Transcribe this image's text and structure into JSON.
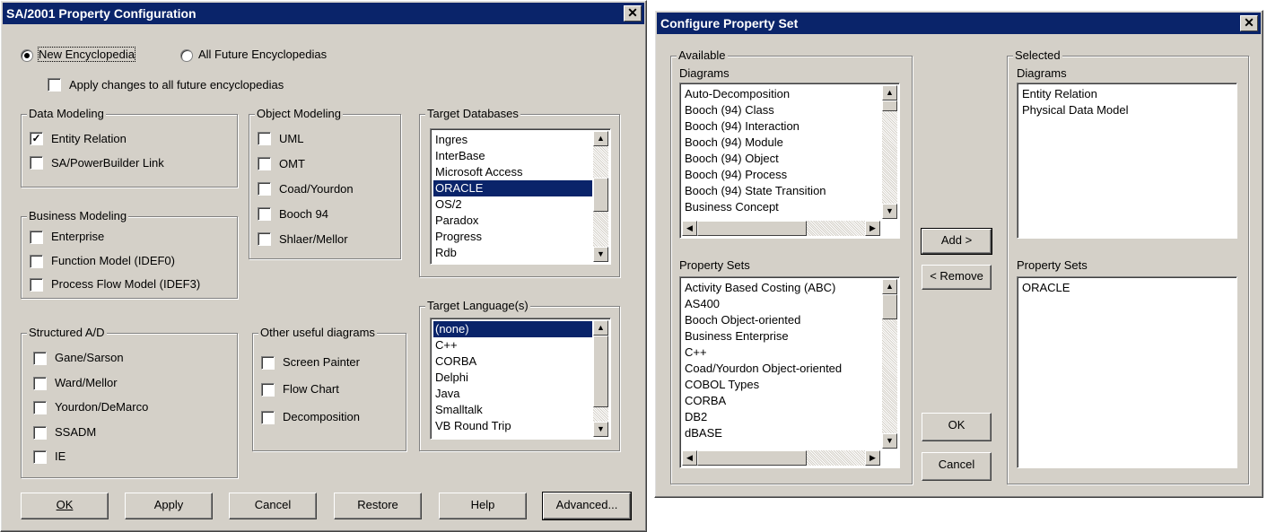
{
  "left": {
    "title": "SA/2001 Property Configuration",
    "radio_new": "New Encyclopedia",
    "radio_future": "All Future Encyclopedias",
    "apply_all_label": "Apply changes to all future encyclopedias",
    "data_modeling": {
      "title": "Data Modeling",
      "items": [
        {
          "label": "Entity Relation",
          "checked": true
        },
        {
          "label": "SA/PowerBuilder Link",
          "checked": false
        }
      ]
    },
    "object_modeling": {
      "title": "Object Modeling",
      "items": [
        {
          "label": "UML",
          "checked": false
        },
        {
          "label": "OMT",
          "checked": false
        },
        {
          "label": "Coad/Yourdon",
          "checked": false
        },
        {
          "label": "Booch 94",
          "checked": false
        },
        {
          "label": "Shlaer/Mellor",
          "checked": false
        }
      ]
    },
    "business_modeling": {
      "title": "Business Modeling",
      "items": [
        {
          "label": "Enterprise",
          "checked": false
        },
        {
          "label": "Function Model (IDEF0)",
          "checked": false
        },
        {
          "label": "Process Flow Model (IDEF3)",
          "checked": false
        }
      ]
    },
    "structured": {
      "title": "Structured A/D",
      "items": [
        {
          "label": "Gane/Sarson",
          "checked": false
        },
        {
          "label": "Ward/Mellor",
          "checked": false
        },
        {
          "label": "Yourdon/DeMarco",
          "checked": false
        },
        {
          "label": "SSADM",
          "checked": false
        },
        {
          "label": "IE",
          "checked": false
        }
      ]
    },
    "other": {
      "title": "Other useful diagrams",
      "items": [
        {
          "label": "Screen Painter",
          "checked": false
        },
        {
          "label": "Flow Chart",
          "checked": false
        },
        {
          "label": "Decomposition",
          "checked": false
        }
      ]
    },
    "target_db": {
      "title": "Target Databases",
      "items": [
        "Ingres",
        "InterBase",
        "Microsoft Access",
        "ORACLE",
        "OS/2",
        "Paradox",
        "Progress",
        "Rdb"
      ],
      "selected": "ORACLE"
    },
    "target_lang": {
      "title": "Target Language(s)",
      "items": [
        "(none)",
        "C++",
        "CORBA",
        "Delphi",
        "Java",
        "Smalltalk",
        "VB Round Trip"
      ],
      "selected": "(none)"
    },
    "buttons": {
      "ok": "OK",
      "apply": "Apply",
      "cancel": "Cancel",
      "restore": "Restore",
      "help": "Help",
      "advanced": "Advanced..."
    }
  },
  "right": {
    "title": "Configure Property Set",
    "available": "Available",
    "selected": "Selected",
    "diagrams_label": "Diagrams",
    "property_sets_label": "Property Sets",
    "available_diagrams": [
      "Auto-Decomposition",
      "Booch (94) Class",
      "Booch (94) Interaction",
      "Booch (94) Module",
      "Booch (94) Object",
      "Booch (94) Process",
      "Booch (94) State Transition",
      "Business Concept"
    ],
    "available_property_sets": [
      "Activity Based Costing (ABC)",
      "AS400",
      "Booch Object-oriented",
      "Business Enterprise",
      "C++",
      "Coad/Yourdon Object-oriented",
      "COBOL Types",
      "CORBA",
      "DB2",
      "dBASE"
    ],
    "selected_diagrams": [
      "Entity Relation",
      "Physical Data Model"
    ],
    "selected_property_sets": [
      "ORACLE"
    ],
    "buttons": {
      "add": "Add >",
      "remove": "< Remove",
      "ok": "OK",
      "cancel": "Cancel"
    }
  },
  "icons": {
    "close": "close-icon",
    "arrow_up": "arrow-up-icon",
    "arrow_down": "arrow-down-icon",
    "arrow_left": "arrow-left-icon",
    "arrow_right": "arrow-right-icon"
  },
  "colors": {
    "face": "#d4d0c8",
    "title": "#0a246a",
    "selection": "#0a246a"
  }
}
